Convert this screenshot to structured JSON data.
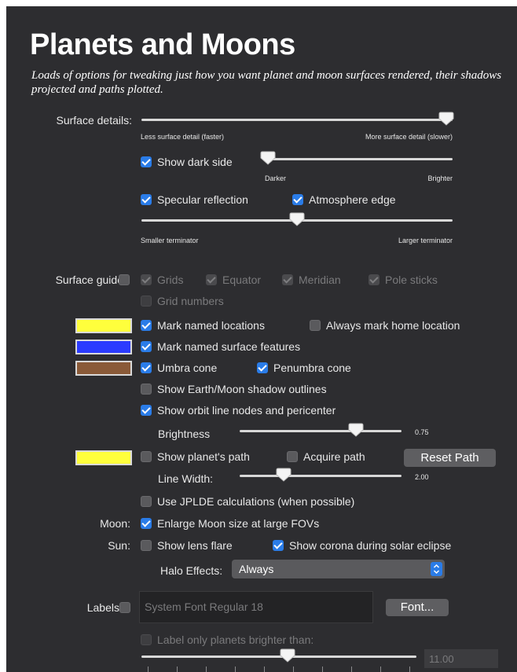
{
  "header": {
    "title": "Planets and Moons",
    "subtitle": "Loads of options for tweaking just how you want planet and moon surfaces rendered, their shadows projected and paths plotted."
  },
  "surface_details": {
    "label": "Surface details:",
    "slider_value": 0.98,
    "left_caption": "Less surface detail (faster)",
    "right_caption": "More surface detail (slower)"
  },
  "dark_side": {
    "label": "Show dark side",
    "checked": true,
    "slider_value": 0.0,
    "left_caption": "Darker",
    "right_caption": "Brighter"
  },
  "specular": {
    "label": "Specular reflection",
    "checked": true
  },
  "atmosphere": {
    "label": "Atmosphere edge",
    "checked": true
  },
  "terminator": {
    "slider_value": 0.5,
    "left_caption": "Smaller terminator",
    "right_caption": "Larger terminator"
  },
  "surface_guides": {
    "label": "Surface guides",
    "checked": false,
    "grids": "Grids",
    "equator": "Equator",
    "meridian": "Meridian",
    "pole_sticks": "Pole sticks",
    "grid_numbers": "Grid numbers"
  },
  "locations": {
    "swatch_color": "#ffff3c",
    "label": "Mark named locations",
    "checked": true,
    "home_label": "Always mark home location",
    "home_checked": false
  },
  "features": {
    "swatch_color": "#2b3bff",
    "label": "Mark named surface features",
    "checked": true
  },
  "umbra": {
    "swatch_color": "#8a5a38",
    "label": "Umbra cone",
    "checked": true,
    "penumbra_label": "Penumbra cone",
    "penumbra_checked": true
  },
  "shadow_outlines": {
    "label": "Show Earth/Moon shadow outlines",
    "checked": false
  },
  "orbit_nodes": {
    "label": "Show orbit line nodes and pericenter",
    "checked": true
  },
  "brightness": {
    "label": "Brightness",
    "value": "0.75",
    "slider_value": 0.72
  },
  "planet_path": {
    "swatch_color": "#ffff3c",
    "label": "Show planet's path",
    "checked": false,
    "acquire_label": "Acquire path",
    "acquire_checked": false,
    "reset_button": "Reset Path"
  },
  "line_width": {
    "label": "Line Width:",
    "value": "2.00",
    "slider_value": 0.27
  },
  "jplde": {
    "label": "Use JPLDE calculations (when possible)",
    "checked": false
  },
  "moon": {
    "label": "Moon:",
    "option_label": "Enlarge Moon size at large FOVs",
    "checked": true
  },
  "sun": {
    "label": "Sun:",
    "lens_flare_label": "Show lens flare",
    "lens_flare_checked": false,
    "corona_label": "Show corona during solar eclipse",
    "corona_checked": true
  },
  "halo": {
    "label": "Halo Effects:",
    "selected": "Always"
  },
  "labels": {
    "label": "Labels",
    "checked": false,
    "font_value": "System Font Regular 18",
    "font_button": "Font...",
    "brighter_label": "Label only planets brighter than:",
    "brighter_checked": false,
    "brighter_value": "11.00",
    "slider_value": 0.53
  },
  "colors": {
    "panel_bg": "#2d2d30",
    "checkbox_accent": "#2a7ce8",
    "disabled_text": "#7a7a7c"
  }
}
